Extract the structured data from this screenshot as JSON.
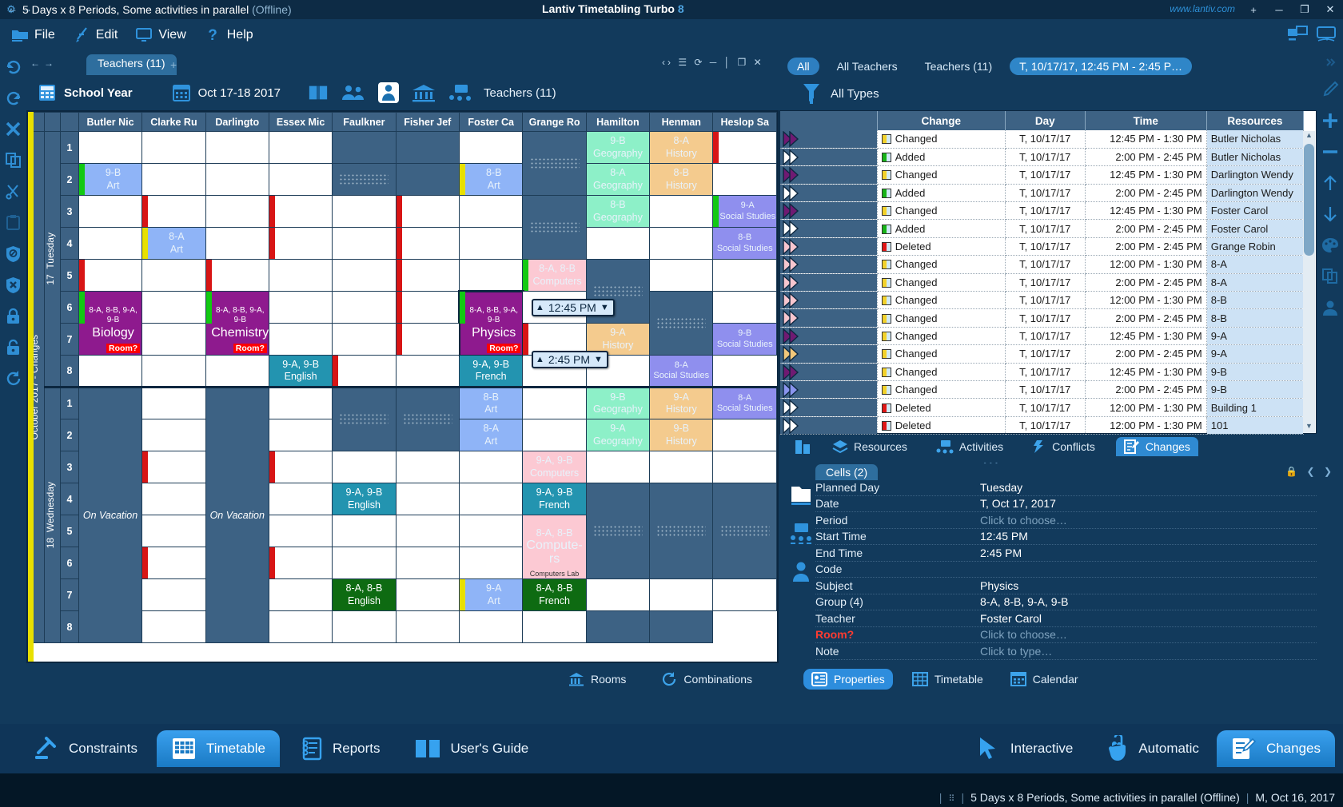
{
  "titlebar": {
    "gear_icon": "gear-icon",
    "title": "5 Days x 8 Periods, Some activities in parallel",
    "offline": "(Offline)",
    "app_name": "Lantiv Timetabling Turbo",
    "app_version": "8",
    "url": "www.lantiv.com",
    "new_tab": "+",
    "minimize": "─",
    "maximize": "❐",
    "close": "✕"
  },
  "menu": {
    "items": [
      {
        "label": "File",
        "icon": "folder-icon"
      },
      {
        "label": "Edit",
        "icon": "pen-icon"
      },
      {
        "label": "View",
        "icon": "monitor-icon"
      },
      {
        "label": "Help",
        "icon": "question-icon"
      }
    ]
  },
  "tabstrip": {
    "back": "←",
    "forward": "→",
    "doc_tab": "Teachers (11)",
    "plus": "+",
    "win_controls": "‹›  ☰  ⟳  ─  │  ❐  ✕"
  },
  "context": {
    "undo_icon": "undo-icon",
    "scope_label": "School Year",
    "scope_icon": "calculator-icon",
    "date_range": "Oct 17-18 2017",
    "date_icon": "calendar-icon",
    "icons": [
      "book-icon",
      "groups-icon",
      "teacher-icon",
      "building-icon",
      "activities-icon"
    ],
    "view_label": "Teachers (11)"
  },
  "filter": {
    "scope_all": "All",
    "all_teachers": "All Teachers",
    "teachers_count": "Teachers (11)",
    "selection": "T, 10/17/17, 12:45 PM - 2:45 P…",
    "types_icon": "funnel-icon",
    "types_label": "All Types"
  },
  "timetable": {
    "teachers": [
      "Butler Nic",
      "Clarke Ru",
      "Darlingto",
      "Essex Mic",
      "Faulkner",
      "Fisher Jef",
      "Foster Ca",
      "Grange Ro",
      "Hamilton",
      "Henman",
      "Heslop Sa"
    ],
    "month_label": "October 2017 - Changes",
    "days": [
      {
        "num": "17",
        "name": "Tuesday"
      },
      {
        "num": "18",
        "name": "Wednesday"
      }
    ],
    "periods": [
      "1",
      "2",
      "3",
      "4",
      "5",
      "6",
      "7",
      "8"
    ],
    "vacation_label": "On Vacation",
    "room_badge": "Room?",
    "computers_lab": "Computers Lab",
    "time_popups": [
      {
        "value": "12:45 PM",
        "up": "▲",
        "down": "▼"
      },
      {
        "value": "2:45 PM",
        "up": "▲",
        "down": "▼"
      }
    ],
    "cells": {
      "art_9b": {
        "l1": "9-B",
        "l2": "Art"
      },
      "art_8a": {
        "l1": "8-A",
        "l2": "Art"
      },
      "art_8b": {
        "l1": "8-B",
        "l2": "Art"
      },
      "art_9a": {
        "l1": "9-A",
        "l2": "Art"
      },
      "biology": {
        "l1": "8-A, 8-B, 9-A, 9-B",
        "l2": "Biology"
      },
      "chemistry": {
        "l1": "8-A, 8-B, 9-A, 9-B",
        "l2": "Chemistry"
      },
      "physics": {
        "l1": "8-A, 8-B, 9-A, 9-B",
        "l2": "Physics"
      },
      "computers_8": {
        "l1": "8-A, 8-B",
        "l2": "Computers"
      },
      "computers_9": {
        "l1": "9-A, 9-B",
        "l2": "Computers"
      },
      "computers_big": {
        "l1": "8-A, 8-B",
        "l2": "Compute-rs"
      },
      "english_9": {
        "l1": "9-A, 9-B",
        "l2": "English"
      },
      "english_8": {
        "l1": "8-A, 8-B",
        "l2": "English"
      },
      "french_9": {
        "l1": "9-A, 9-B",
        "l2": "French"
      },
      "french_8": {
        "l1": "8-A, 8-B",
        "l2": "French"
      },
      "geo_9b": {
        "l1": "9-B",
        "l2": "Geography"
      },
      "geo_9a": {
        "l1": "9-A",
        "l2": "Geography"
      },
      "geo_8a": {
        "l1": "8-A",
        "l2": "Geography"
      },
      "geo_8b": {
        "l1": "8-B",
        "l2": "Geography"
      },
      "hist_8a": {
        "l1": "8-A",
        "l2": "History"
      },
      "hist_8b": {
        "l1": "8-B",
        "l2": "History"
      },
      "hist_9a": {
        "l1": "9-A",
        "l2": "History"
      },
      "hist_9b": {
        "l1": "9-B",
        "l2": "History"
      },
      "soc_9a": {
        "l1": "9-A",
        "l2": "Social Studies"
      },
      "soc_9b": {
        "l1": "9-B",
        "l2": "Social Studies"
      },
      "soc_8a": {
        "l1": "8-A",
        "l2": "Social Studies"
      },
      "soc_8b": {
        "l1": "8-B",
        "l2": "Social Studies"
      }
    }
  },
  "changes": {
    "columns": [
      "Change",
      "Day",
      "Time",
      "Resources"
    ],
    "rows": [
      {
        "type": "Changed",
        "day": "T, 10/17/17",
        "time": "12:45 PM - 1:30 PM",
        "resource": "Butler Nicholas",
        "arrow": "#6f1a72",
        "chip": "#f2d12a"
      },
      {
        "type": "Added",
        "day": "T, 10/17/17",
        "time": "2:00 PM - 2:45 PM",
        "resource": "Butler Nicholas",
        "arrow": "#ffffff",
        "chip": "#17b317"
      },
      {
        "type": "Changed",
        "day": "T, 10/17/17",
        "time": "12:45 PM - 1:30 PM",
        "resource": "Darlington Wendy",
        "arrow": "#6f1a72",
        "chip": "#f2d12a"
      },
      {
        "type": "Added",
        "day": "T, 10/17/17",
        "time": "2:00 PM - 2:45 PM",
        "resource": "Darlington Wendy",
        "arrow": "#ffffff",
        "chip": "#17b317"
      },
      {
        "type": "Changed",
        "day": "T, 10/17/17",
        "time": "12:45 PM - 1:30 PM",
        "resource": "Foster Carol",
        "arrow": "#6f1a72",
        "chip": "#f2d12a"
      },
      {
        "type": "Added",
        "day": "T, 10/17/17",
        "time": "2:00 PM - 2:45 PM",
        "resource": "Foster Carol",
        "arrow": "#ffffff",
        "chip": "#17b317"
      },
      {
        "type": "Deleted",
        "day": "T, 10/17/17",
        "time": "2:00 PM - 2:45 PM",
        "resource": "Grange Robin",
        "arrow": "#f7c6cf",
        "chip": "#e01616"
      },
      {
        "type": "Changed",
        "day": "T, 10/17/17",
        "time": "12:00 PM - 1:30 PM",
        "resource": "8-A",
        "arrow": "#f7c6cf",
        "chip": "#f2d12a"
      },
      {
        "type": "Changed",
        "day": "T, 10/17/17",
        "time": "2:00 PM - 2:45 PM",
        "resource": "8-A",
        "arrow": "#f7c6cf",
        "chip": "#f2d12a"
      },
      {
        "type": "Changed",
        "day": "T, 10/17/17",
        "time": "12:00 PM - 1:30 PM",
        "resource": "8-B",
        "arrow": "#f7c6cf",
        "chip": "#f2d12a"
      },
      {
        "type": "Changed",
        "day": "T, 10/17/17",
        "time": "2:00 PM - 2:45 PM",
        "resource": "8-B",
        "arrow": "#f7c6cf",
        "chip": "#f2d12a"
      },
      {
        "type": "Changed",
        "day": "T, 10/17/17",
        "time": "12:45 PM - 1:30 PM",
        "resource": "9-A",
        "arrow": "#6f1a72",
        "chip": "#f2d12a"
      },
      {
        "type": "Changed",
        "day": "T, 10/17/17",
        "time": "2:00 PM - 2:45 PM",
        "resource": "9-A",
        "arrow": "#f2c77a",
        "chip": "#f2d12a"
      },
      {
        "type": "Changed",
        "day": "T, 10/17/17",
        "time": "12:45 PM - 1:30 PM",
        "resource": "9-B",
        "arrow": "#6f1a72",
        "chip": "#f2d12a"
      },
      {
        "type": "Changed",
        "day": "T, 10/17/17",
        "time": "2:00 PM - 2:45 PM",
        "resource": "9-B",
        "arrow": "#8a95ee",
        "chip": "#f2d12a"
      },
      {
        "type": "Deleted",
        "day": "T, 10/17/17",
        "time": "12:00 PM - 1:30 PM",
        "resource": "Building 1",
        "arrow": "#ffffff",
        "chip": "#e01616"
      },
      {
        "type": "Deleted",
        "day": "T, 10/17/17",
        "time": "12:00 PM - 1:30 PM",
        "resource": "101",
        "arrow": "#ffffff",
        "chip": "#e01616"
      }
    ]
  },
  "right_tabs": {
    "building_icon": "building-icon",
    "items": [
      {
        "label": "Resources",
        "icon": "resources-icon",
        "active": false
      },
      {
        "label": "Activities",
        "icon": "activities-icon",
        "active": false
      },
      {
        "label": "Conflicts",
        "icon": "conflicts-icon",
        "active": false
      },
      {
        "label": "Changes",
        "icon": "changes-icon",
        "active": true
      }
    ],
    "overflow": "•••"
  },
  "properties": {
    "back": "←",
    "forward": "→",
    "tab_label": "Cells (2)",
    "rows": [
      {
        "key": "Planned Day",
        "value": "Tuesday",
        "placeholder": false
      },
      {
        "key": "Date",
        "value": "T, Oct 17, 2017",
        "placeholder": false
      },
      {
        "key": "Period",
        "value": "Click to choose…",
        "placeholder": true
      },
      {
        "key": "Start Time",
        "value": "12:45 PM",
        "placeholder": false
      },
      {
        "key": "End Time",
        "value": "2:45 PM",
        "placeholder": false
      },
      {
        "key": "Code",
        "value": "",
        "placeholder": false
      },
      {
        "key": "Subject",
        "value": "Physics",
        "placeholder": false
      },
      {
        "key": "Group (4)",
        "value": "8-A, 8-B, 9-A, 9-B",
        "placeholder": false
      },
      {
        "key": "Teacher",
        "value": "Foster Carol",
        "placeholder": false
      },
      {
        "key": "Room?",
        "value": "Click to choose…",
        "placeholder": true,
        "red": true
      },
      {
        "key": "Note",
        "value": "Click to type…",
        "placeholder": true
      }
    ]
  },
  "subbar_left": {
    "items": [
      {
        "label": "Rooms",
        "icon": "building-icon"
      },
      {
        "label": "Combinations",
        "icon": "refresh-icon"
      }
    ]
  },
  "subbar_right": {
    "items": [
      {
        "label": "Properties",
        "icon": "properties-icon",
        "active": true
      },
      {
        "label": "Timetable",
        "icon": "timetable-icon",
        "active": false
      },
      {
        "label": "Calendar",
        "icon": "calendar-icon",
        "active": false
      }
    ]
  },
  "bottombar": {
    "left_items": [
      {
        "label": "Constraints",
        "icon": "gavel-icon",
        "active": false
      },
      {
        "label": "Timetable",
        "icon": "grid-icon",
        "active": true
      },
      {
        "label": "Reports",
        "icon": "reports-icon",
        "active": false
      },
      {
        "label": "User's Guide",
        "icon": "book-icon",
        "active": false
      }
    ],
    "right_items": [
      {
        "label": "Interactive",
        "icon": "cursor-icon",
        "active": false
      },
      {
        "label": "Automatic",
        "icon": "hand-icon",
        "active": false
      },
      {
        "label": "Changes",
        "icon": "changes-icon",
        "active": true
      }
    ]
  },
  "statusbar": {
    "grip": "⠿",
    "project": "5 Days x 8 Periods, Some activities in parallel (Offline)",
    "date": "M, Oct 16, 2017"
  }
}
